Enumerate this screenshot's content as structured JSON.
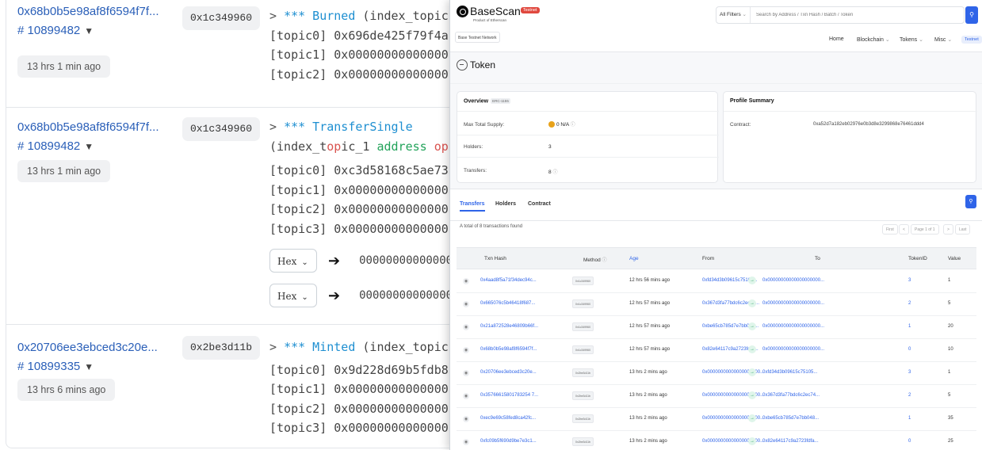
{
  "logs": [
    {
      "tx_hash": "0x68b0b5e98af8f6594f7f...",
      "block": "# 10899482",
      "age": "13 hrs 1 min ago",
      "method": "0x1c349960",
      "lines": [
        "> *** Burned (index_topic",
        "[topic0] 0x696de425f79f4a",
        "[topic1] 0x00000000000000",
        "[topic2] 0x00000000000000"
      ]
    },
    {
      "tx_hash": "0x68b0b5e98af8f6594f7f...",
      "block": "# 10899482",
      "age": "13 hrs 1 min ago",
      "method": "0x1c349960",
      "lines": [
        "> *** TransferSingle",
        "(index_topic_1 address op",
        "[topic0] 0xc3d58168c5ae73",
        "[topic1] 0x00000000000000",
        "[topic2] 0x00000000000000",
        "[topic3] 0x00000000000000"
      ],
      "hex_rows": [
        {
          "format": "Hex",
          "value": "000000000000000"
        },
        {
          "format": "Hex",
          "value": "000000000000000"
        }
      ]
    },
    {
      "tx_hash": "0x20706ee3ebced3c20e...",
      "block": "# 10899335",
      "age": "13 hrs 6 mins ago",
      "method": "0x2be3d11b",
      "lines": [
        "> *** Minted (index_topic",
        "[topic0] 0x9d228d69b5fdb8",
        "[topic1] 0x00000000000000",
        "[topic2] 0x00000000000000",
        "[topic3] 0x00000000000000"
      ]
    }
  ],
  "basescan": {
    "logo": {
      "name": "BaseScan",
      "badge": "Testnet",
      "subtitle": "Product of Etherscan"
    },
    "network_button": "Base Testnet Network",
    "search": {
      "filter": "All Filters",
      "placeholder": "Search by Address / Txn Hash / Batch / Token"
    },
    "nav": [
      "Home",
      "Blockchain",
      "Tokens",
      "Misc",
      "Testnet"
    ],
    "token_title": "Token",
    "overview": {
      "title": "Overview",
      "chip": "ERC-1155",
      "max_supply_label": "Max Total Supply:",
      "max_supply_value": "0 N/A",
      "holders_label": "Holders:",
      "holders_value": "3",
      "transfers_label": "Transfers:",
      "transfers_value": "8"
    },
    "profile": {
      "title": "Profile Summary",
      "contract_label": "Contract:",
      "contract_value": "0xa52d7a182eb02976e0b3d8e3299868e76461ddd4"
    },
    "tabs": [
      "Transfers",
      "Holders",
      "Contract"
    ],
    "found_text": "A total of 8 transactions found",
    "pager": [
      "First",
      "<",
      "Page 1 of 1",
      ">",
      "Last"
    ],
    "columns": [
      "Txn Hash",
      "Method",
      "Age",
      "From",
      "To",
      "TokenID",
      "Value"
    ],
    "rows": [
      {
        "hash": "0x4aad8f5a71f34dec94c...",
        "method": "0x1c349960",
        "age": "12 hrs 56 mins ago",
        "from": "0xfd34d3b09615c75105...",
        "to": "0x00000000000000000000...",
        "token_id": "3",
        "value": "1"
      },
      {
        "hash": "0x665076c5b46418f687...",
        "method": "0x1c349960",
        "age": "12 hrs 57 mins ago",
        "from": "0x367d3fa77bdc6c2ec74...",
        "to": "0x00000000000000000000...",
        "token_id": "2",
        "value": "5"
      },
      {
        "hash": "0x21a872528e46809b66f...",
        "method": "0x1c349960",
        "age": "12 hrs 57 mins ago",
        "from": "0xbe65cb785d7e7bb048...",
        "to": "0x00000000000000000000...",
        "token_id": "1",
        "value": "20"
      },
      {
        "hash": "0x68b0b5e98af8f6594f7f...",
        "method": "0x1c349960",
        "age": "12 hrs 57 mins ago",
        "from": "0x82e64117c9a2723fdfa...",
        "to": "0x00000000000000000000...",
        "token_id": "0",
        "value": "10"
      },
      {
        "hash": "0x20706ee3ebced3c20e...",
        "method": "0x2be3d11b",
        "age": "13 hrs 2 mins ago",
        "from": "0x00000000000000000000...",
        "to": "0xfd34d3b09615c75105...",
        "token_id": "3",
        "value": "1"
      },
      {
        "hash": "0x35766615801783254 7...",
        "method": "0x2be3d11b",
        "age": "13 hrs 2 mins ago",
        "from": "0x00000000000000000000...",
        "to": "0x367d3fa77bdc6c2ec74...",
        "token_id": "2",
        "value": "5"
      },
      {
        "hash": "0xec9e69c58fed8ca42fc...",
        "method": "0x2be3d11b",
        "age": "13 hrs 2 mins ago",
        "from": "0x00000000000000000000...",
        "to": "0xbe65cb785d7e7bb048...",
        "token_id": "1",
        "value": "35"
      },
      {
        "hash": "0xfc09b5f690d9be7e3c1...",
        "method": "0x2be3d11b",
        "age": "13 hrs 2 mins ago",
        "from": "0x00000000000000000000...",
        "to": "0x82e64117c9a2723fdfa...",
        "token_id": "0",
        "value": "25"
      }
    ]
  }
}
